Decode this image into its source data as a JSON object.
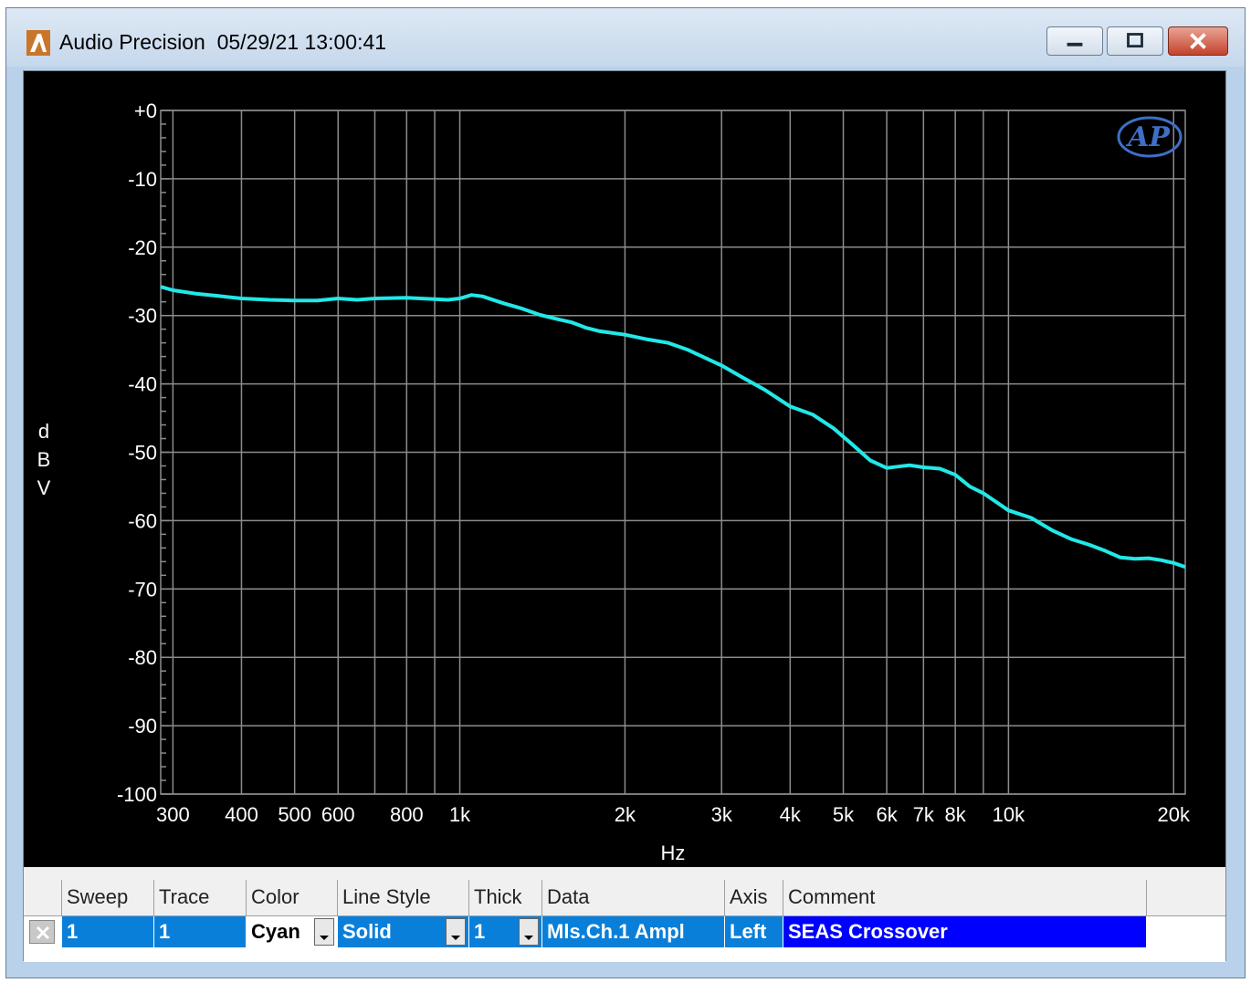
{
  "window": {
    "title": "Audio Precision  05/29/21 13:00:41",
    "icon": "audio-precision-app-icon",
    "controls": [
      "minimize-icon",
      "maximize-icon",
      "close-icon"
    ]
  },
  "chart_data": {
    "type": "line",
    "title": "",
    "xlabel": "Hz",
    "ylabel": "dBV",
    "ylabel_chars": [
      "d",
      "B",
      "V"
    ],
    "x_scale": "log",
    "xlim": [
      285,
      21000
    ],
    "ylim": [
      -100,
      0
    ],
    "x_ticks": [
      {
        "value": 300,
        "label": "300"
      },
      {
        "value": 400,
        "label": "400"
      },
      {
        "value": 500,
        "label": "500"
      },
      {
        "value": 600,
        "label": "600"
      },
      {
        "value": 800,
        "label": "800"
      },
      {
        "value": 1000,
        "label": "1k"
      },
      {
        "value": 2000,
        "label": "2k"
      },
      {
        "value": 3000,
        "label": "3k"
      },
      {
        "value": 4000,
        "label": "4k"
      },
      {
        "value": 5000,
        "label": "5k"
      },
      {
        "value": 6000,
        "label": "6k"
      },
      {
        "value": 7000,
        "label": "7k"
      },
      {
        "value": 8000,
        "label": "8k"
      },
      {
        "value": 10000,
        "label": "10k"
      },
      {
        "value": 20000,
        "label": "20k"
      }
    ],
    "x_gridlines": [
      300,
      400,
      500,
      600,
      700,
      800,
      900,
      1000,
      2000,
      3000,
      4000,
      5000,
      6000,
      7000,
      8000,
      9000,
      10000,
      20000
    ],
    "y_ticks": [
      {
        "value": 0,
        "label": "+0"
      },
      {
        "value": -10,
        "label": "-10"
      },
      {
        "value": -20,
        "label": "-20"
      },
      {
        "value": -30,
        "label": "-30"
      },
      {
        "value": -40,
        "label": "-40"
      },
      {
        "value": -50,
        "label": "-50"
      },
      {
        "value": -60,
        "label": "-60"
      },
      {
        "value": -70,
        "label": "-70"
      },
      {
        "value": -80,
        "label": "-80"
      },
      {
        "value": -90,
        "label": "-90"
      },
      {
        "value": -100,
        "label": "-100"
      }
    ],
    "grid": true,
    "logo": "AP",
    "series": [
      {
        "color": "#22e8e8",
        "x": [
          285,
          300,
          330,
          360,
          400,
          450,
          500,
          550,
          600,
          650,
          700,
          800,
          900,
          950,
          1000,
          1050,
          1100,
          1200,
          1300,
          1400,
          1500,
          1600,
          1700,
          1800,
          2000,
          2200,
          2400,
          2600,
          2800,
          3000,
          3300,
          3600,
          4000,
          4400,
          4800,
          5200,
          5600,
          6000,
          6300,
          6600,
          7000,
          7500,
          8000,
          8500,
          9000,
          10000,
          11000,
          12000,
          13000,
          14000,
          15000,
          16000,
          17000,
          18000,
          19000,
          20000,
          21000
        ],
        "y": [
          -25.8,
          -26.3,
          -26.8,
          -27.1,
          -27.5,
          -27.7,
          -27.8,
          -27.8,
          -27.5,
          -27.7,
          -27.5,
          -27.4,
          -27.6,
          -27.7,
          -27.5,
          -27.0,
          -27.2,
          -28.2,
          -29.0,
          -29.9,
          -30.5,
          -31.0,
          -31.8,
          -32.3,
          -32.8,
          -33.5,
          -34.0,
          -35.0,
          -36.2,
          -37.3,
          -39.2,
          -40.9,
          -43.3,
          -44.5,
          -46.5,
          -48.9,
          -51.2,
          -52.3,
          -52.1,
          -51.9,
          -52.2,
          -52.4,
          -53.3,
          -55.0,
          -56.0,
          -58.5,
          -59.6,
          -61.4,
          -62.7,
          -63.5,
          -64.4,
          -65.4,
          -65.6,
          -65.5,
          -65.8,
          -66.2,
          -66.8
        ]
      }
    ]
  },
  "legend": {
    "headers": [
      "Sweep",
      "Trace",
      "Color",
      "Line Style",
      "Thick",
      "Data",
      "Axis",
      "Comment"
    ],
    "rows": [
      {
        "sweep": "1",
        "trace": "1",
        "color": "Cyan",
        "line_style": "Solid",
        "thick": "1",
        "data": "Mls.Ch.1 Ampl",
        "axis": "Left",
        "comment": "SEAS Crossover",
        "enabled_icon": "checkbox-x-icon",
        "dropdown_icon": "dropdown-arrow-icon"
      }
    ]
  }
}
